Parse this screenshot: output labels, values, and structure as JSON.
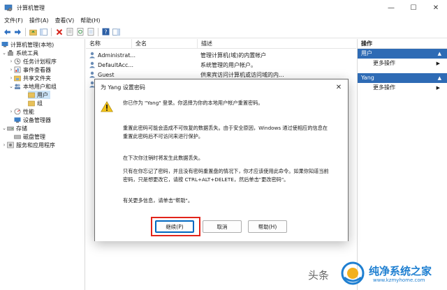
{
  "window": {
    "title": "计算机管理",
    "controls": {
      "minimize": "—",
      "maximize": "☐",
      "close": "✕"
    }
  },
  "menu": [
    "文件(F)",
    "操作(A)",
    "查看(V)",
    "帮助(H)"
  ],
  "tree": {
    "root": "计算机管理(本地)",
    "system_tools": "系统工具",
    "task_scheduler": "任务计划程序",
    "event_viewer": "事件查看器",
    "shared_folders": "共享文件夹",
    "local_users_groups": "本地用户和组",
    "users": "用户",
    "groups": "组",
    "performance": "性能",
    "device_manager": "设备管理器",
    "storage": "存储",
    "disk_management": "磁盘管理",
    "services_apps": "服务和应用程序"
  },
  "list": {
    "columns": [
      "名称",
      "全名",
      "描述"
    ],
    "rows": [
      {
        "name": "Administrat...",
        "desc": "管理计算机(域)的内置帐户"
      },
      {
        "name": "DefaultAcc...",
        "desc": "系统管理的用户帐户。"
      },
      {
        "name": "Guest",
        "desc": "供来宾访问计算机或访问域的内..."
      },
      {
        "name": "",
        "desc": ""
      }
    ]
  },
  "actions": {
    "title": "操作",
    "sec1": "用户",
    "more1": "更多操作",
    "sec2": "Yang",
    "more2": "更多操作"
  },
  "dialog": {
    "title": "为 Yang 设置密码",
    "line1": "你已作为 \"Yang\" 登录。你选择为你的本地用户帐户重置密码。",
    "line2a": "重置此密码可能会造成不可恢复的数据丢失。由于安全原因，Windows 通过使相应的信息在",
    "line2b": "重置此密码后不可访问来进行保护。",
    "line3": "在下次你注销时将发生此数据丢失。",
    "line4a": "只有在你忘记了密码，并且没有密码重置盘的情况下，你才应该使用此命令。如果你知道当前",
    "line4b": "密码，只是想更改它，请按 CTRL+ALT+DELETE，然后单击\"更改密码\"。",
    "line5": "有关更多信息，请单击\"帮助\"。",
    "btn_continue": "继续(P)",
    "btn_cancel": "取消",
    "btn_help": "帮助(H)"
  },
  "watermark": {
    "prefix": "头条",
    "name": "纯净系统之家",
    "url": "www.kzmyhome.com"
  },
  "colors": {
    "accent": "#0067c0",
    "action_header": "#2e6bb5",
    "highlight": "#e2241a",
    "selection": "#cce4f7"
  }
}
